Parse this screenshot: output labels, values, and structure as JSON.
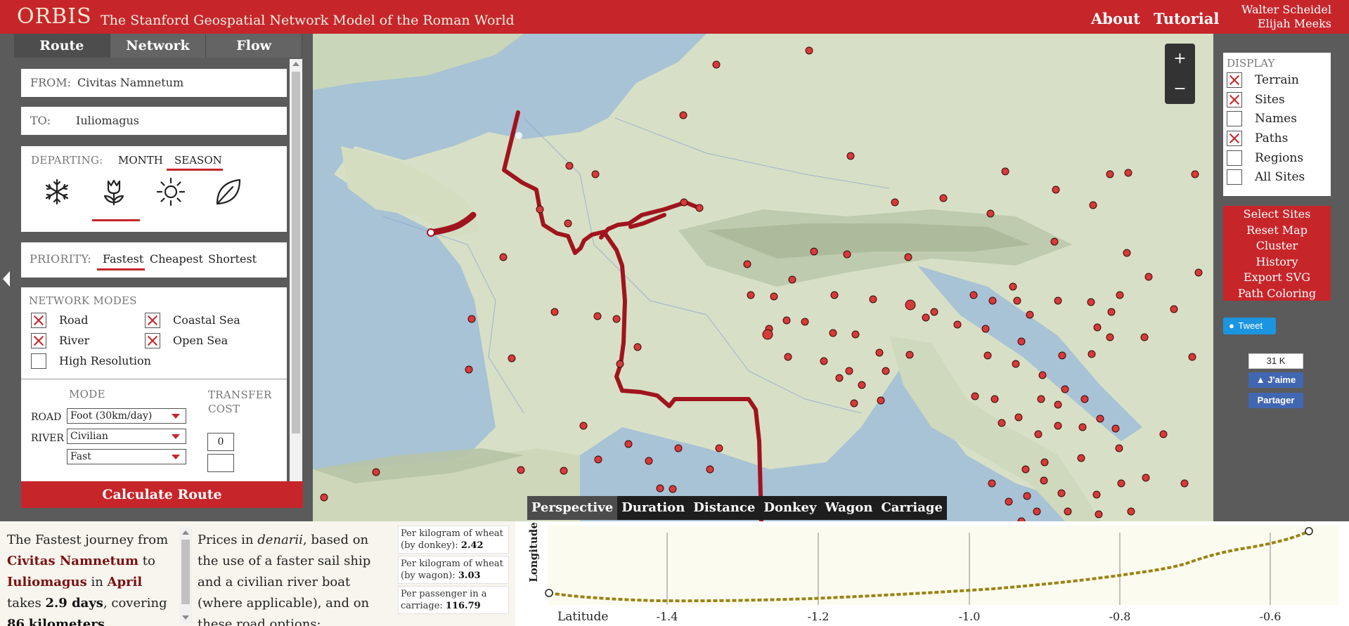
{
  "header": {
    "logo": "ORBIS",
    "subtitle": "The Stanford Geospatial Network Model of the Roman World",
    "nav": [
      "About",
      "Tutorial"
    ],
    "authors": [
      "Walter Scheidel",
      "Elijah Meeks"
    ]
  },
  "tabs": [
    "Route",
    "Network",
    "Flow"
  ],
  "route": {
    "from_label": "FROM:",
    "from_value": "Civitas Namnetum",
    "to_label": "TO:",
    "to_value": "Iuliomagus",
    "departing_label": "DEPARTING:",
    "departing_options": [
      "MONTH",
      "SEASON"
    ],
    "departing_selected": "SEASON",
    "seasons": [
      "winter-icon",
      "spring-icon",
      "summer-icon",
      "autumn-icon"
    ],
    "season_selected": "spring",
    "priority_label": "PRIORITY:",
    "priority_options": [
      "Fastest",
      "Cheapest",
      "Shortest"
    ],
    "priority_selected": "Fastest",
    "modes_label": "NETWORK MODES",
    "modes": [
      {
        "label": "Road",
        "checked": true
      },
      {
        "label": "Coastal Sea",
        "checked": true
      },
      {
        "label": "River",
        "checked": true
      },
      {
        "label": "Open Sea",
        "checked": true
      },
      {
        "label": "High Resolution",
        "checked": false
      }
    ],
    "mode_header": "MODE",
    "transfer_header": "TRANSFER COST",
    "rows": [
      {
        "label": "ROAD",
        "select": "Foot (30km/day)"
      },
      {
        "label": "RIVER",
        "select": "Civilian"
      }
    ],
    "extra_select": "Fast",
    "transfer_value": "0",
    "calculate_label": "Calculate Route"
  },
  "display": {
    "title": "DISPLAY",
    "items": [
      {
        "label": "Terrain",
        "checked": true
      },
      {
        "label": "Sites",
        "checked": true
      },
      {
        "label": "Names",
        "checked": false
      },
      {
        "label": "Paths",
        "checked": true
      },
      {
        "label": "Regions",
        "checked": false
      },
      {
        "label": "All Sites",
        "checked": false
      }
    ]
  },
  "actions": [
    "Select Sites",
    "Reset Map",
    "Cluster",
    "History",
    "Export SVG",
    "Path Coloring"
  ],
  "social": {
    "tweet": "Tweet",
    "fb_count": "31 K",
    "fb_like": "J'aime",
    "fb_share": "Partager"
  },
  "zoom": {
    "in": "+",
    "out": "−"
  },
  "view_tabs": [
    "Perspective",
    "Duration",
    "Distance",
    "Donkey",
    "Wagon",
    "Carriage"
  ],
  "view_selected": "Perspective",
  "summary": {
    "p1": "The Fastest journey from",
    "origin": "Civitas Namnetum",
    "p2": "to",
    "destination": "Iuliomagus",
    "p3": "in",
    "month": "April",
    "p4": "takes",
    "days": "2.9 days",
    "p5": ", covering",
    "km": "86",
    "p6": "kilometers."
  },
  "prices": {
    "p1": "Prices in",
    "currency": "denarii",
    "p2": ", based on the use of a faster sail ship and a civilian river boat (where applicable), and on these road options:"
  },
  "costs": [
    {
      "label": "Per kilogram of wheat (by donkey):",
      "value": "2.42"
    },
    {
      "label": "Per kilogram of wheat (by wagon):",
      "value": "3.03"
    },
    {
      "label": "Per passenger in a carriage:",
      "value": "116.79"
    }
  ],
  "profile": {
    "y_label": "Longitude",
    "x_label": "Latitude",
    "ticks": [
      "-1.4",
      "-1.2",
      "-1.0",
      "-0.8",
      "-0.6"
    ]
  },
  "colors": {
    "accent": "#c6262a",
    "route": "#a0141e",
    "profile_line": "#9b8312"
  }
}
